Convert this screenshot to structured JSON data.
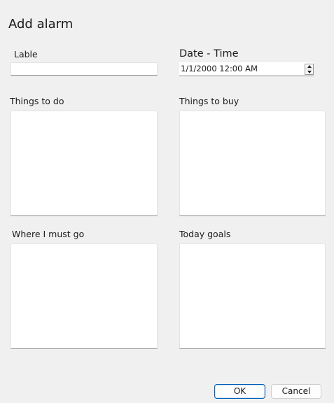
{
  "window": {
    "title": "Add alarm"
  },
  "label_field": {
    "label": "Lable",
    "value": ""
  },
  "datetime_field": {
    "label": "Date - Time",
    "value": "1/1/2000 12:00 AM"
  },
  "things_to_do": {
    "label": "Things to do",
    "value": ""
  },
  "things_to_buy": {
    "label": "Things to buy",
    "value": ""
  },
  "where_i_must_go": {
    "label": "Where I must go",
    "value": ""
  },
  "today_goals": {
    "label": "Today goals",
    "value": ""
  },
  "buttons": {
    "ok": "OK",
    "cancel": "Cancel"
  },
  "colors": {
    "background": "#f0f0f0",
    "field": "#ffffff",
    "accent": "#005fb8"
  }
}
